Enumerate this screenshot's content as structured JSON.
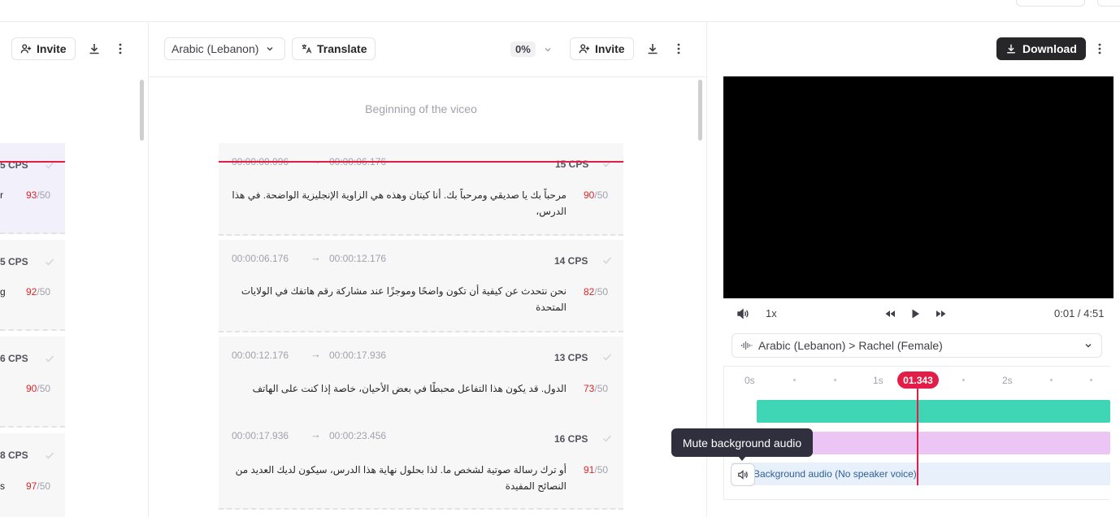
{
  "left_panel": {
    "invite_label": "Invite",
    "rows": [
      {
        "cps": "5 CPS",
        "snippet": "r",
        "count": "93",
        "max": "/50"
      },
      {
        "cps": "5 CPS",
        "snippet": "g",
        "count": "92",
        "max": "/50"
      },
      {
        "cps": "6 CPS",
        "snippet": "",
        "count": "90",
        "max": "/50"
      },
      {
        "cps": "8 CPS",
        "snippet": "s",
        "count": "97",
        "max": "/50"
      }
    ]
  },
  "center_panel": {
    "language": "Arabic (Lebanon)",
    "translate_label": "Translate",
    "progress": "0%",
    "invite_label": "Invite",
    "beginning_label": "Beginning of the viceo",
    "rows": [
      {
        "start": "00:00:00.096",
        "end": "00:00:06.176",
        "cps": "15 CPS",
        "count": "90",
        "max": "/50",
        "text": "مرحباً بك يا صديقي ومرحباً بك. أنا كيتان وهذه هي الزاوية الإنجليزية الواضحة. في هذا الدرس،"
      },
      {
        "start": "00:00:06.176",
        "end": "00:00:12.176",
        "cps": "14 CPS",
        "count": "82",
        "max": "/50",
        "text": "نحن نتحدث عن كيفية أن تكون واضحًا وموجزًا عند مشاركة رقم هاتفك في الولايات المتحدة"
      },
      {
        "start": "00:00:12.176",
        "end": "00:00:17.936",
        "cps": "13 CPS",
        "count": "73",
        "max": "/50",
        "text": "الدول. قد يكون هذا التفاعل محبطًا في بعض الأحيان، خاصة إذا كنت على الهاتف"
      },
      {
        "start": "00:00:17.936",
        "end": "00:00:23.456",
        "cps": "16 CPS",
        "count": "91",
        "max": "/50",
        "text": "أو ترك رسالة صوتية لشخص ما. لذا بحلول نهاية هذا الدرس، سيكون لديك العديد من النصائح المفيدة"
      }
    ]
  },
  "right_panel": {
    "download_label": "Download",
    "speed": "1x",
    "time": "0:01 / 4:51",
    "voice": "Arabic (Lebanon) > Rachel (Female)",
    "ticks": [
      "0s",
      "1s",
      "2s"
    ],
    "playhead": "01.343",
    "background_track": "Background audio (No speaker voice)",
    "tooltip": "Mute background audio"
  },
  "icons": {
    "user_plus": "user-plus-icon",
    "download": "download-icon",
    "more": "more-vertical-icon",
    "translate": "translate-icon",
    "chevron": "chevron-down-icon",
    "check": "check-icon",
    "volume": "volume-icon",
    "rewind": "rewind-icon",
    "play": "play-icon",
    "forward": "fast-forward-icon",
    "waveform": "waveform-icon"
  },
  "colors": {
    "accent_red": "#e11d48",
    "download_bg": "#27272a",
    "track_green": "#3ed6b5",
    "track_pink": "#ebc6f5",
    "background_track": "#e7f0fb"
  }
}
